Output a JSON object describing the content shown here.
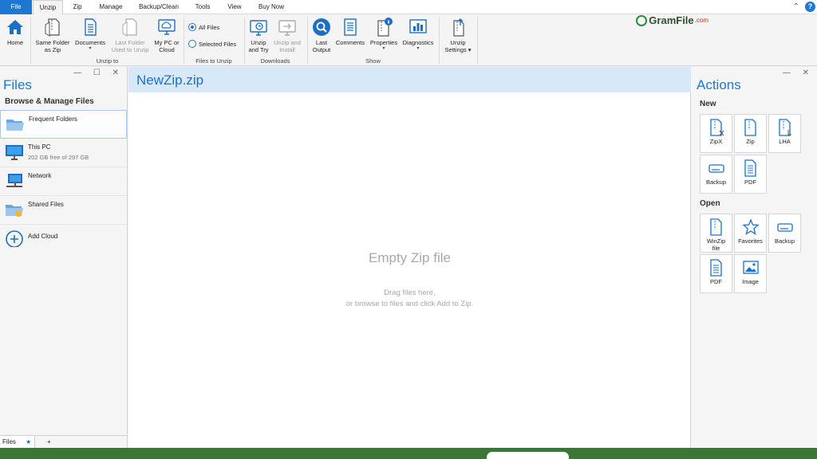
{
  "menu_tabs": [
    "File",
    "Unzip",
    "Zip",
    "Manage",
    "Backup/Clean",
    "Tools",
    "View",
    "Buy Now"
  ],
  "window_controls": {
    "collapse": "⌃",
    "help": "?"
  },
  "logo": {
    "text": "GramFile",
    "suffix": ".com"
  },
  "ribbon": {
    "home": "Home",
    "same_folder": [
      "Same Folder",
      "as Zip"
    ],
    "documents": [
      "Documents",
      "▾"
    ],
    "last_folder": [
      "Last Folder",
      "Used to Unzip"
    ],
    "my_pc": [
      "My PC or",
      "Cloud"
    ],
    "unzip_to_label": "Unzip to",
    "all_files": "All Files",
    "selected_files": "Selected Files",
    "files_to_unzip_label": "Files to Unzip",
    "unzip_try": [
      "Unzip",
      "and Try"
    ],
    "unzip_install": [
      "Unzip and",
      "Install"
    ],
    "downloads_label": "Downloads",
    "last_output": [
      "Last",
      "Output"
    ],
    "comments": "Comments",
    "properties": [
      "Properties",
      "▾"
    ],
    "diagnostics": [
      "Diagnostics",
      "▾"
    ],
    "show_label": "Show",
    "unzip_settings": [
      "Unzip",
      "Settings ▾"
    ]
  },
  "left_panel": {
    "title": "Files",
    "subtitle": "Browse & Manage Files",
    "controls": "— ☐ ✕",
    "items": [
      {
        "name": "Frequent Folders",
        "detail": ""
      },
      {
        "name": "This PC",
        "detail": "202 GB free of 297 GB"
      },
      {
        "name": "Network",
        "detail": ""
      },
      {
        "name": "Shared Files",
        "detail": ""
      },
      {
        "name": "Add Cloud",
        "detail": ""
      }
    ],
    "bottom_tabs": {
      "files": "Files",
      "pin": "★",
      "add": "+"
    }
  },
  "center": {
    "title": "NewZip.zip",
    "empty_title": "Empty Zip file",
    "empty_line1": "Drag files here,",
    "empty_line2": "or browse to files and click Add to Zip."
  },
  "right_panel": {
    "title": "Actions",
    "controls": "— ✕",
    "new_label": "New",
    "new_items": [
      "ZipX",
      "Zip",
      "LHA",
      "Backup",
      "PDF"
    ],
    "open_label": "Open",
    "open_items": [
      [
        "WinZip",
        "file"
      ],
      [
        "Favorites",
        ""
      ],
      [
        "Backup",
        ""
      ],
      [
        "PDF",
        ""
      ],
      [
        "Image",
        ""
      ]
    ]
  },
  "colors": {
    "accent": "#1e78d2",
    "ribbon_bg": "#f4f4f4",
    "header_bg": "#d7e9f9",
    "status_bar": "#3a7734"
  }
}
